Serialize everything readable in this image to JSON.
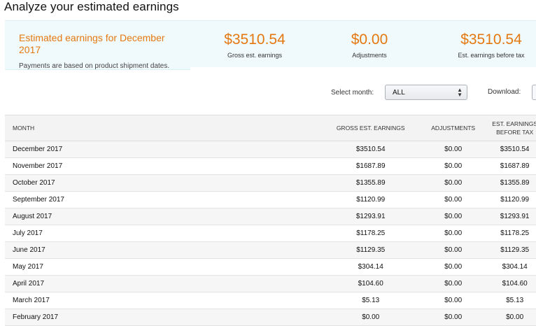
{
  "page": {
    "title": "Analyze your estimated earnings"
  },
  "summary": {
    "period_label": "Estimated earnings for December 2017",
    "note": "Payments are based on product shipment dates.",
    "gross": {
      "value": "$3510.54",
      "label": "Gross est. earnings"
    },
    "adjustments": {
      "value": "$0.00",
      "label": "Adjustments"
    },
    "est_before_tax": {
      "value": "$3510.54",
      "label": "Est. earnings before tax"
    }
  },
  "controls": {
    "select_month_label": "Select month:",
    "select_month_value": "ALL",
    "download_label": "Download:"
  },
  "table": {
    "headers": {
      "month": "MONTH",
      "gross": "GROSS EST. EARNINGS",
      "adjustments": "ADJUSTMENTS",
      "est_line1": "EST. EARNINGS",
      "est_line2": "BEFORE TAX"
    },
    "rows": [
      {
        "month": "December 2017",
        "gross": "$3510.54",
        "adj": "$0.00",
        "est": "$3510.54"
      },
      {
        "month": "November 2017",
        "gross": "$1687.89",
        "adj": "$0.00",
        "est": "$1687.89"
      },
      {
        "month": "October 2017",
        "gross": "$1355.89",
        "adj": "$0.00",
        "est": "$1355.89"
      },
      {
        "month": "September 2017",
        "gross": "$1120.99",
        "adj": "$0.00",
        "est": "$1120.99"
      },
      {
        "month": "August 2017",
        "gross": "$1293.91",
        "adj": "$0.00",
        "est": "$1293.91"
      },
      {
        "month": "July 2017",
        "gross": "$1178.25",
        "adj": "$0.00",
        "est": "$1178.25"
      },
      {
        "month": "June 2017",
        "gross": "$1129.35",
        "adj": "$0.00",
        "est": "$1129.35"
      },
      {
        "month": "May 2017",
        "gross": "$304.14",
        "adj": "$0.00",
        "est": "$304.14"
      },
      {
        "month": "April 2017",
        "gross": "$104.60",
        "adj": "$0.00",
        "est": "$104.60"
      },
      {
        "month": "March 2017",
        "gross": "$5.13",
        "adj": "$0.00",
        "est": "$5.13"
      },
      {
        "month": "February 2017",
        "gross": "$0.00",
        "adj": "$0.00",
        "est": "$0.00"
      }
    ]
  },
  "colors": {
    "accent": "#e47911",
    "summary_bg": "#f0f9fc",
    "header_bg": "#f3f3f3"
  }
}
